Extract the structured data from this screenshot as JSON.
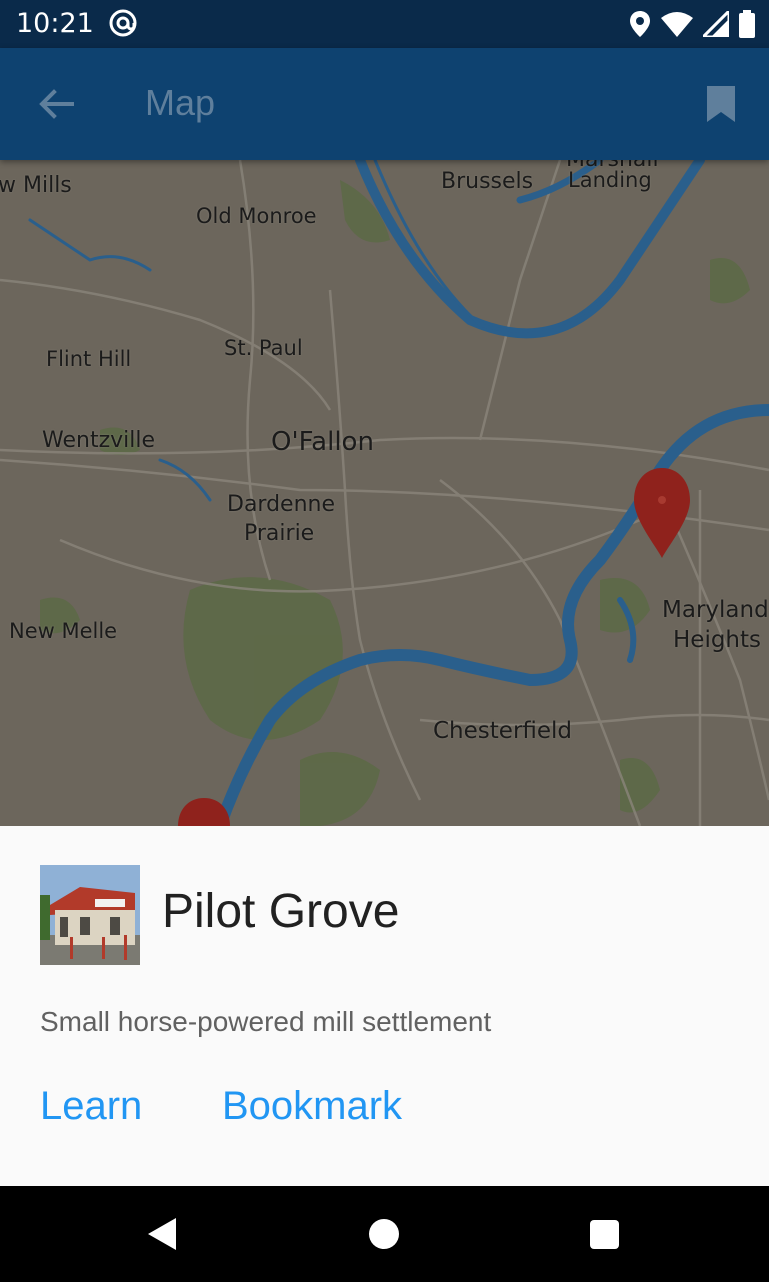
{
  "status_bar": {
    "time": "10:21",
    "icons": [
      "at-sign-icon",
      "location-pin-icon",
      "wifi-icon",
      "signal-icon",
      "battery-icon"
    ]
  },
  "app_bar": {
    "title": "Map",
    "back_icon": "arrow-back-icon",
    "bookmark_icon": "bookmark-icon",
    "background": "#0e4270"
  },
  "map": {
    "labels": {
      "w_mills": "w Mills",
      "old_monroe": "Old Monroe",
      "brussels": "Brussels",
      "marshall": "Marshall",
      "landing": "Landing",
      "flint_hill": "Flint Hill",
      "st_paul": "St. Paul",
      "wentzville": "Wentzville",
      "ofallon": "O'Fallon",
      "dardenne": "Dardenne",
      "prairie": "Prairie",
      "new_melle": "New Melle",
      "maryland": "Maryland",
      "heights": "Heights",
      "chesterfield": "Chesterfield"
    },
    "markers": [
      "map-marker-pin-icon",
      "map-marker-pin-icon"
    ],
    "colors": {
      "land": "#6c665c",
      "water": "#2a5f8c",
      "park": "#5d6b46",
      "marker": "#8f221c"
    }
  },
  "place": {
    "name": "Pilot Grove",
    "description": "Small horse-powered mill settlement",
    "learn_label": "Learn",
    "bookmark_label": "Bookmark",
    "accent": "#2196f3"
  },
  "nav_bar": {
    "icons": [
      "nav-back-icon",
      "nav-home-icon",
      "nav-recents-icon"
    ]
  }
}
